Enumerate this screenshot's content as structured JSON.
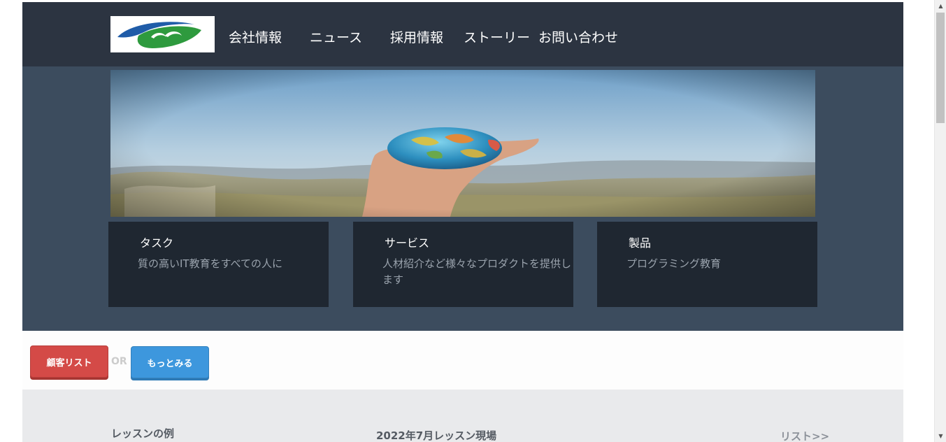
{
  "nav": {
    "items": [
      "会社情報",
      "ニュース",
      "採用情報",
      "ストーリー",
      "お問い合わせ"
    ]
  },
  "cards": [
    {
      "title": "タスク",
      "desc": "質の高いIT教育をすべての人に"
    },
    {
      "title": "サービス",
      "desc": "人材紹介など様々なプロダクトを提供します"
    },
    {
      "title": "製品",
      "desc": "プログラミング教育"
    }
  ],
  "actions": {
    "customer_label": "顧客リスト",
    "or_label": "OR",
    "more_label": "もっとみる"
  },
  "lessons": {
    "left_label": "レッスンの例",
    "center_label": "2022年7月レッスン現場",
    "right_label": "リスト>>"
  },
  "icons": {
    "logo": "company-logo",
    "scroll_up": "scroll-up-icon",
    "scroll_down": "scroll-down-icon"
  },
  "colors": {
    "topbar": "#2c3441",
    "hero": "#3c4c5e",
    "card": "#1f2731",
    "customer_button": "#d44a47",
    "more_button": "#3d97dd",
    "lessons_bg": "#e9eaec"
  }
}
